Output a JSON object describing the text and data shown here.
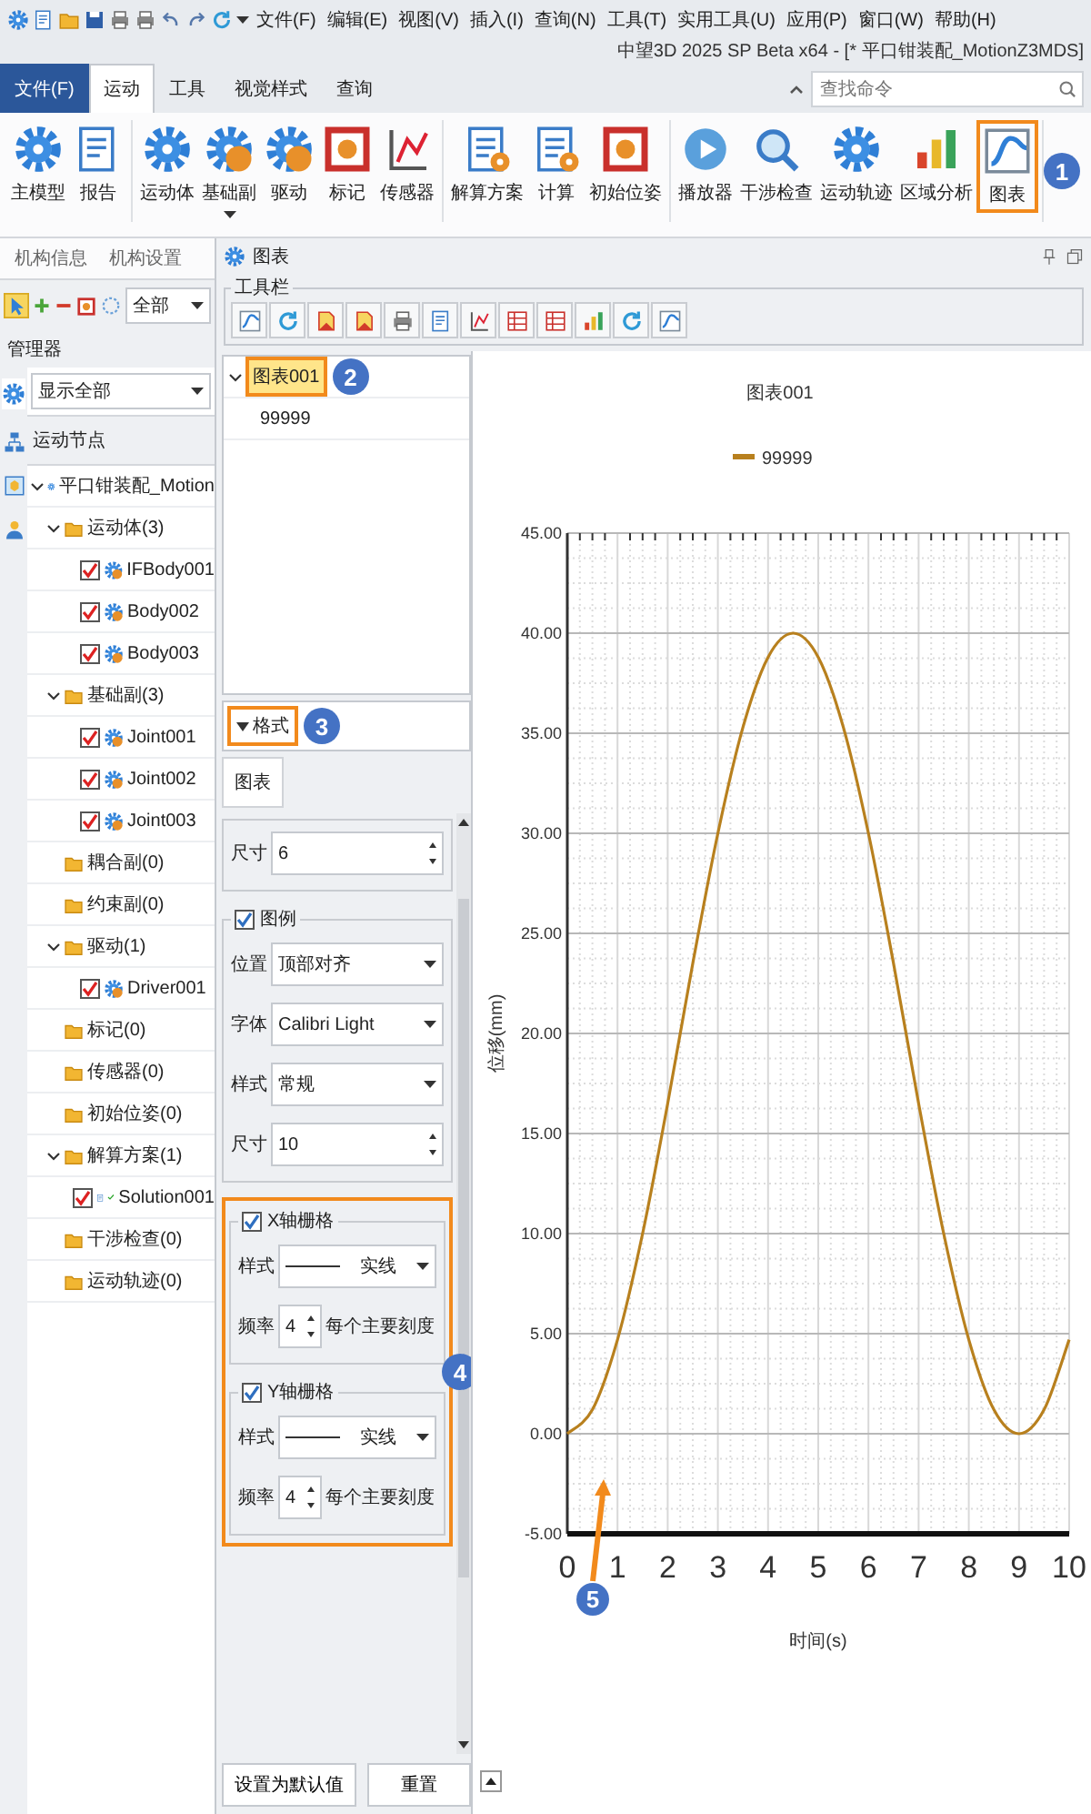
{
  "menu_bar": [
    "文件(F)",
    "编辑(E)",
    "视图(V)",
    "插入(I)",
    "查询(N)",
    "工具(T)",
    "实用工具(U)",
    "应用(P)",
    "窗口(W)",
    "帮助(H)"
  ],
  "window": {
    "title": "中望3D 2025 SP Beta x64 - [* 平口钳装配_MotionZ3MDS]"
  },
  "ribbon": {
    "tabs": [
      {
        "label": "文件(F)",
        "kind": "file",
        "selected": false
      },
      {
        "label": "运动",
        "kind": "tab",
        "selected": true
      },
      {
        "label": "工具",
        "kind": "tab",
        "selected": false
      },
      {
        "label": "视觉样式",
        "kind": "tab",
        "selected": false
      },
      {
        "label": "查询",
        "kind": "tab",
        "selected": false
      }
    ],
    "search": {
      "placeholder": "查找命令"
    },
    "groups": [
      {
        "label": "机构信息",
        "items": [
          {
            "label": "主模型"
          },
          {
            "label": "报告"
          }
        ]
      },
      {
        "label": "机构设置",
        "items": [
          {
            "label": "运动体"
          },
          {
            "label": "基础副",
            "dropdown": true
          },
          {
            "label": "驱动"
          },
          {
            "label": "标记"
          },
          {
            "label": "传感器"
          }
        ]
      },
      {
        "items": [
          {
            "label": "解算方案"
          },
          {
            "label": "计算"
          },
          {
            "label": "初始位姿"
          }
        ]
      },
      {
        "items": [
          {
            "label": "播放器"
          },
          {
            "label": "干涉检查"
          },
          {
            "label": "运动轨迹"
          },
          {
            "label": "区域分析"
          },
          {
            "label": "图表",
            "callout": "1"
          }
        ]
      }
    ]
  },
  "manager": {
    "filter": "全部",
    "title": "管理器",
    "view": "显示全部",
    "header": "运动节点",
    "tree": [
      {
        "label": "平口钳装配_Motion",
        "expanded": true,
        "children": [
          {
            "label": "运动体(3)",
            "expanded": true,
            "children": [
              {
                "label": "IFBody001",
                "checked": true
              },
              {
                "label": "Body002",
                "checked": true
              },
              {
                "label": "Body003",
                "checked": true
              }
            ]
          },
          {
            "label": "基础副(3)",
            "expanded": true,
            "children": [
              {
                "label": "Joint001",
                "checked": true
              },
              {
                "label": "Joint002",
                "checked": true
              },
              {
                "label": "Joint003",
                "checked": true
              }
            ]
          },
          {
            "label": "耦合副(0)"
          },
          {
            "label": "约束副(0)"
          },
          {
            "label": "驱动(1)",
            "expanded": true,
            "children": [
              {
                "label": "Driver001",
                "checked": true
              }
            ]
          },
          {
            "label": "标记(0)"
          },
          {
            "label": "传感器(0)"
          },
          {
            "label": "初始位姿(0)"
          },
          {
            "label": "解算方案(1)",
            "expanded": true,
            "children": [
              {
                "label": "Solution001",
                "checked": true,
                "solved": true
              }
            ]
          },
          {
            "label": "干涉检查(0)"
          },
          {
            "label": "运动轨迹(0)"
          }
        ]
      }
    ]
  },
  "chart_panel": {
    "title": "图表",
    "toolbar_title": "工具栏",
    "charts": [
      {
        "label": "图表001",
        "selected": true,
        "expanded": true,
        "callout": "2",
        "children": [
          {
            "label": "99999",
            "selected": false
          }
        ]
      }
    ],
    "format": {
      "label": "格式",
      "expanded": true,
      "callout": "3",
      "tabs": [
        {
          "label": "图表",
          "selected": true
        }
      ],
      "groups": [
        {
          "kind": "plain",
          "rows": [
            {
              "kind": "spin",
              "label": "尺寸",
              "value": "6"
            }
          ]
        },
        {
          "kind": "check",
          "label": "图例",
          "checked": true,
          "rows": [
            {
              "kind": "select",
              "label": "位置",
              "value": "顶部对齐"
            },
            {
              "kind": "select",
              "label": "字体",
              "value": "Calibri Light"
            },
            {
              "kind": "select",
              "label": "样式",
              "value": "常规"
            },
            {
              "kind": "spin",
              "label": "尺寸",
              "value": "10"
            }
          ]
        }
      ],
      "highlight": {
        "callout": "4",
        "groups": [
          {
            "kind": "check",
            "label": "X轴栅格",
            "checked": true,
            "rows": [
              {
                "kind": "line-select",
                "label": "样式",
                "value": "实线"
              },
              {
                "kind": "spin",
                "label": "频率",
                "value": "4",
                "suffix": "每个主要刻度"
              }
            ]
          },
          {
            "kind": "check",
            "label": "Y轴栅格",
            "checked": true,
            "rows": [
              {
                "kind": "line-select",
                "label": "样式",
                "value": "实线"
              },
              {
                "kind": "spin",
                "label": "频率",
                "value": "4",
                "suffix": "每个主要刻度"
              }
            ]
          }
        ]
      },
      "buttons": [
        "设置为默认值",
        "重置"
      ]
    },
    "chart": {
      "chart_data": {
        "type": "line",
        "title": "图表001",
        "xlabel": "时间(s)",
        "ylabel": "位移(mm)",
        "x": [
          0,
          0.5,
          1,
          1.5,
          2,
          2.5,
          3,
          3.5,
          4,
          4.5,
          5,
          5.5,
          6,
          6.5,
          7,
          7.5,
          8,
          8.5,
          9,
          9.5,
          10
        ],
        "series": [
          {
            "name": "99999",
            "color": "#b8801e",
            "values": [
              0,
              1.2,
              4.7,
              10,
              16.5,
              23.5,
              30,
              35.3,
              38.8,
              40,
              38.8,
              35.3,
              30,
              23.5,
              16.5,
              10,
              4.7,
              1.2,
              0,
              1.2,
              4.7
            ]
          }
        ],
        "grid": true,
        "xlim": [
          0,
          10
        ],
        "ylim": [
          -5,
          45
        ],
        "xticks": [
          0,
          1,
          2,
          3,
          4,
          5,
          6,
          7,
          8,
          9,
          10
        ],
        "yticks": [
          {
            "value": -5,
            "label": "-5.00"
          },
          {
            "value": 0,
            "label": "0.00"
          },
          {
            "value": 5,
            "label": "5.00"
          },
          {
            "value": 10,
            "label": "10.00"
          },
          {
            "value": 15,
            "label": "15.00"
          },
          {
            "value": 20,
            "label": "20.00"
          },
          {
            "value": 25,
            "label": "25.00"
          },
          {
            "value": 30,
            "label": "30.00"
          },
          {
            "value": 35,
            "label": "35.00"
          },
          {
            "value": 40,
            "label": "40.00"
          },
          {
            "value": 45,
            "label": "45.00"
          }
        ],
        "annotations": [
          "5"
        ]
      }
    }
  }
}
